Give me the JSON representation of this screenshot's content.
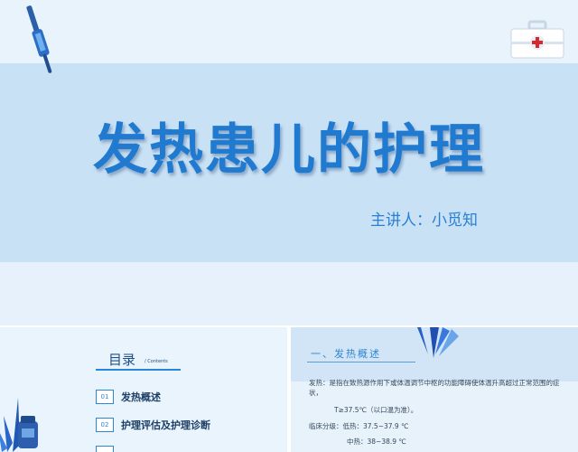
{
  "main_slide": {
    "title": "发热患儿的护理",
    "presenter": "主讲人：小觅知"
  },
  "toc_slide": {
    "title": "目录",
    "subtitle": "/ Contents",
    "items": [
      {
        "num": "01",
        "label": "发热概述"
      },
      {
        "num": "02",
        "label": "护理评估及护理诊断"
      }
    ]
  },
  "overview_slide": {
    "section_title": "一、发热概述",
    "definition": "发热：是指在致热源作用下或体温调节中枢的功能障碍使体温升高超过正常范围的症状，",
    "threshold": "T≥37.5℃（以口温为准）。",
    "classification_low": "临床分级：低热：37.5~37.9 ℃",
    "classification_mid": "中热：38~38.9 ℃"
  },
  "colors": {
    "title_blue": "#1f7ad0",
    "band_blue": "#c9e1f4",
    "accent_blue": "#2a86d8"
  }
}
